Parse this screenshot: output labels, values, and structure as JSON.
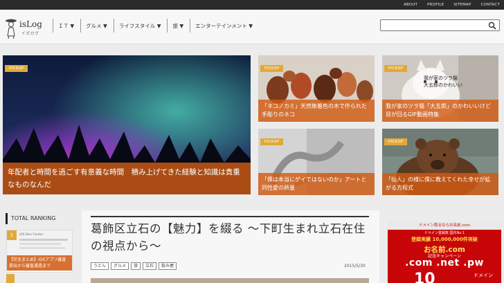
{
  "toplinks": [
    "ABOUT",
    "PROFILE",
    "SITEMAP",
    "CONTACT"
  ],
  "logo": {
    "name": "isLog",
    "subtitle": "イズログ"
  },
  "nav": [
    "ＩＴ ▼",
    "グルメ ▼",
    "ライフスタイル ▼",
    "旅 ▼",
    "エンターテインメント ▼"
  ],
  "search": {
    "value": "",
    "placeholder": ""
  },
  "pickup_label": "PICKUP",
  "features": [
    {
      "caption": "年配者と時間を過ごす有意義な時間　積み上げてきた経験と知識は貴重なものなんだ"
    },
    {
      "caption": "「ネコノカミ」天然無着色の木で作られた手彫りのネコ"
    },
    {
      "caption": "我が家のツラ猫「大五郎」のかわいいけど目が回るGIF動画特集",
      "overlay": "我が家のツラ猫 大五郎のかわいい"
    },
    {
      "caption": "「僕は本当にゲイではないのか」アートと同性愛の熱量"
    },
    {
      "caption": "「仙人」の様に僕に教えてくれた幸せが拡がる方程式"
    }
  ],
  "sidebar": {
    "title": "TOTAL RANKING",
    "rank_number": "1",
    "rank_small_text": "iOS Dev Center",
    "rank_caption": "【完全まとめ】iOSアプリ審査提出から審査通過まで"
  },
  "article": {
    "title": "葛飾区立石の【魅力】を綴る 〜下町生まれ立石在住の視点から〜",
    "tags": [
      "うどん",
      "グルメ",
      "旅",
      "立石",
      "飲み屋"
    ],
    "date": "2015/5/30"
  },
  "ad": {
    "top": "ドメイン取るならお名前.com",
    "line1": "ドメイン登録数 国内No.1",
    "line2": "登録実績 10,000,000件突破",
    "line3": "お名前.com",
    "line4": "記念キャンペーン",
    "domains": ".com .net .pw",
    "big_number": "10",
    "domain_word": "ドメイン"
  },
  "colors": {
    "accent": "#e2a93a",
    "caption_bg": "#d25c14",
    "topbar": "#2b2b2b",
    "ad_red": "#c8060a"
  }
}
